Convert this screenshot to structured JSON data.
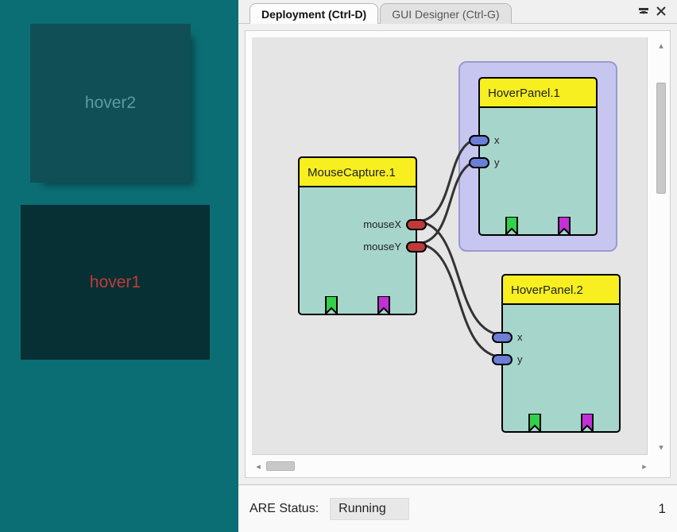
{
  "preview": {
    "hover2_label": "hover2",
    "hover1_label": "hover1"
  },
  "tabs": {
    "deployment": "Deployment (Ctrl-D)",
    "gui_designer": "GUI Designer (Ctrl-G)"
  },
  "blocks": {
    "mouseCapture": {
      "title": "MouseCapture.1",
      "ports": {
        "out1": "mouseX",
        "out2": "mouseY"
      }
    },
    "hoverPanel1": {
      "title": "HoverPanel.1",
      "ports": {
        "in1": "x",
        "in2": "y"
      }
    },
    "hoverPanel2": {
      "title": "HoverPanel.2",
      "ports": {
        "in1": "x",
        "in2": "y"
      }
    }
  },
  "status": {
    "label": "ARE Status:",
    "value": "Running",
    "trail": "1"
  },
  "icons": {
    "minimize": "minimize-icon",
    "close": "close-icon"
  }
}
